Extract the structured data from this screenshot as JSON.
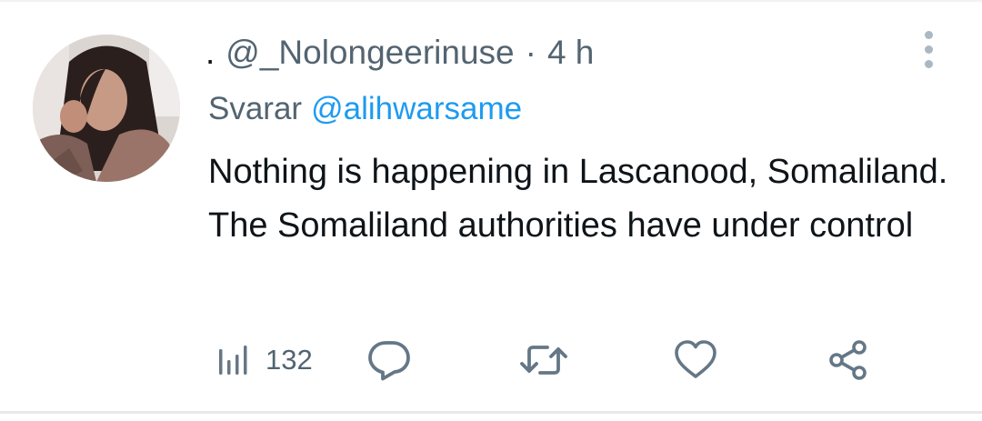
{
  "tweet": {
    "prefix_dot": ".",
    "handle": "@_Nolongeerinuse",
    "separator": "·",
    "time": "4 h",
    "reply_label": "Svarar",
    "reply_to": "@alihwarsame",
    "text": "Nothing is happening in Lascanood, Somaliland. The Somaliland authorities have under control"
  },
  "actions": {
    "views_count": "132",
    "icons": [
      "views-icon",
      "reply-icon",
      "retweet-icon",
      "like-icon",
      "share-icon"
    ]
  },
  "colors": {
    "text_primary": "#0f1419",
    "text_secondary": "#536471",
    "link": "#1d9bf0",
    "icon": "#657786"
  }
}
